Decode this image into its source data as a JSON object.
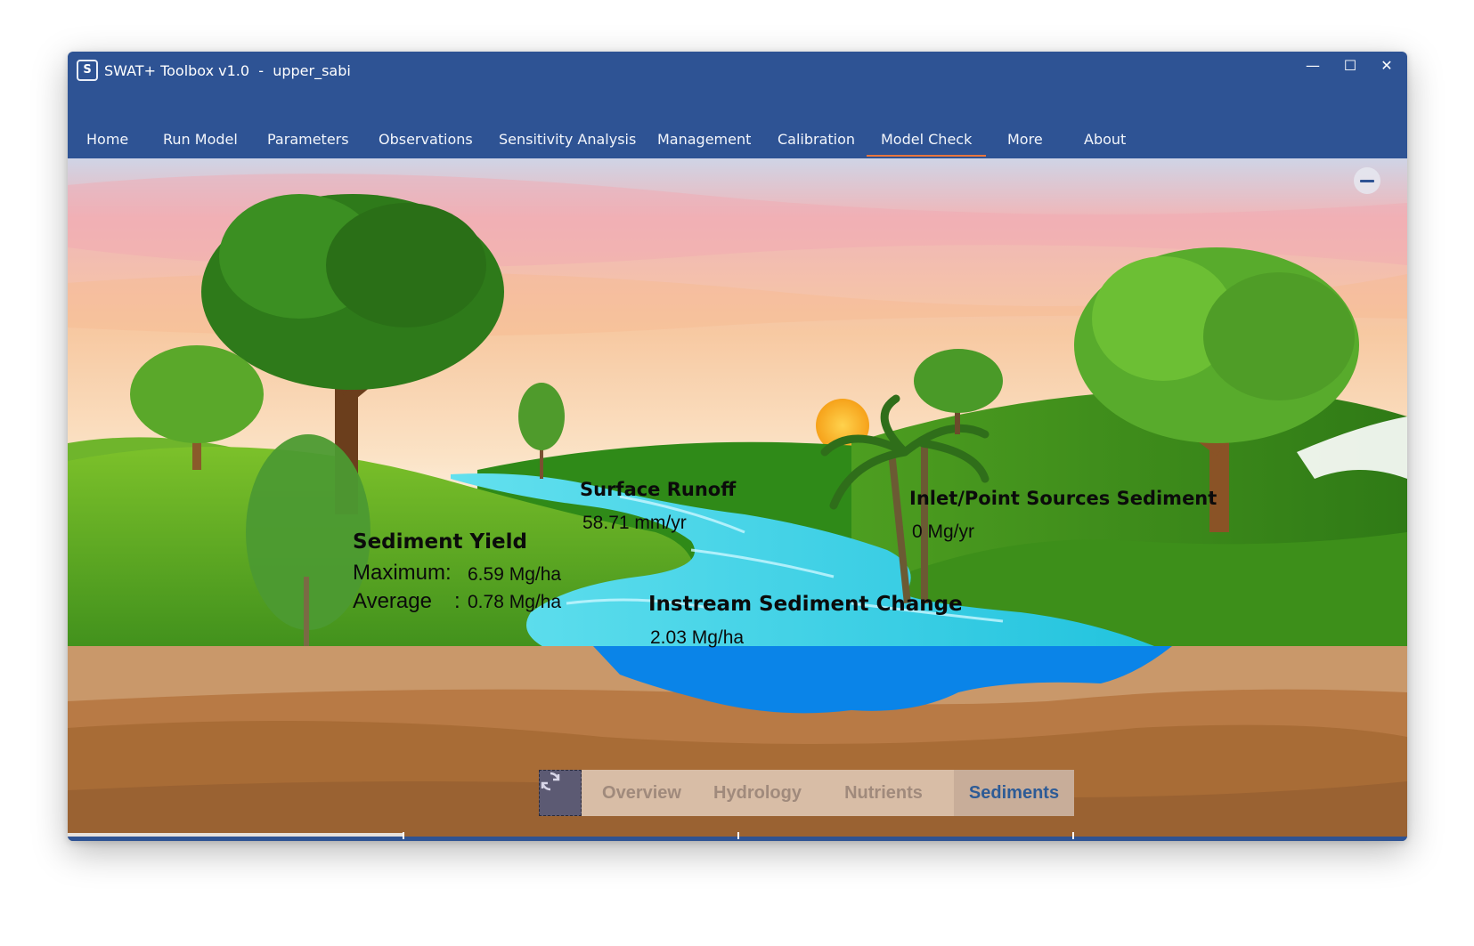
{
  "window": {
    "title": "SWAT+ Toolbox v1.0  -  upper_sabi",
    "icon_text": "S",
    "controls": {
      "minimize": "—",
      "maximize": "☐",
      "close": "✕"
    }
  },
  "menu": {
    "items": [
      {
        "label": "Home"
      },
      {
        "label": "Run Model"
      },
      {
        "label": "Parameters"
      },
      {
        "label": "Observations"
      },
      {
        "label": "Sensitivity Analysis"
      },
      {
        "label": "Management"
      },
      {
        "label": "Calibration"
      },
      {
        "label": "Model Check"
      },
      {
        "label": "More"
      },
      {
        "label": "About"
      }
    ],
    "active": "Model Check"
  },
  "scene": {
    "sediment_yield": {
      "title": "Sediment Yield",
      "maximum_label": "Maximum:",
      "maximum_value": "6.59 Mg/ha",
      "average_label": "Average",
      "average_sep": ":",
      "average_value": "0.78 Mg/ha"
    },
    "surface_runoff": {
      "title": "Surface Runoff",
      "value": "58.71 mm/yr"
    },
    "inlet": {
      "title": "Inlet/Point Sources Sediment",
      "value": "0 Mg/yr"
    },
    "instream": {
      "title": "Instream Sediment Change",
      "value": "2.03 Mg/ha"
    }
  },
  "tabs": {
    "items": [
      {
        "label": "Overview"
      },
      {
        "label": "Hydrology"
      },
      {
        "label": "Nutrients"
      },
      {
        "label": "Sediments"
      }
    ],
    "active": "Sediments"
  },
  "progress": {
    "value_fraction": 0.25
  },
  "colors": {
    "chrome": "#2e5394",
    "accent_underline": "#e8763e",
    "water": "#0a84e8",
    "river": "#3fd0e6",
    "grass": "#4a9e1e",
    "soil": "#a86c36"
  },
  "icons": {
    "refresh": "refresh-icon",
    "collapse": "minus-icon",
    "app": "app-icon"
  }
}
